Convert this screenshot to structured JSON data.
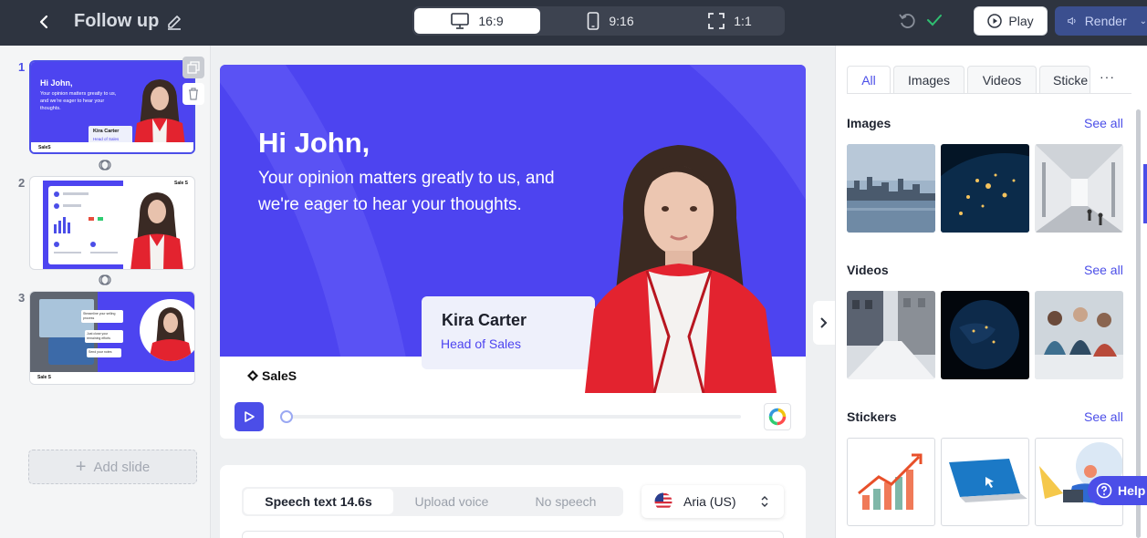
{
  "header": {
    "title": "Follow up",
    "ratios": [
      {
        "label": "16:9",
        "icon": "monitor-icon",
        "active": true
      },
      {
        "label": "9:16",
        "icon": "phone-icon",
        "active": false
      },
      {
        "label": "1:1",
        "icon": "square-frame-icon",
        "active": false
      }
    ],
    "play_label": "Play",
    "render_label": "Render"
  },
  "slides": {
    "items": [
      {
        "number": "1",
        "active": true,
        "greeting": "Hi John,",
        "message": "Your opinion matters greatly to us, and we're eager to hear your thoughts.",
        "name": "Kira Carter",
        "role": "Head of Sales",
        "brand": "SaleS"
      },
      {
        "number": "2",
        "active": false,
        "brand": "Sale S"
      },
      {
        "number": "3",
        "active": false,
        "bubble_1": "Streamline your selling process",
        "bubble_2": "Just close your remaining efforts",
        "bubble_3": "Send your notes",
        "brand": "Sale S"
      }
    ],
    "add_label": "Add slide"
  },
  "canvas": {
    "greeting": "Hi John,",
    "message": "Your opinion matters greatly to us, and we're eager to hear your thoughts.",
    "name": "Kira Carter",
    "role": "Head of Sales",
    "brand": "SaleS",
    "playback_progress": 0
  },
  "speech": {
    "tabs": [
      "Speech text 14.6s",
      "Upload voice",
      "No speech"
    ],
    "active_tab": 0,
    "voice": "Aria (US)"
  },
  "media": {
    "tabs": [
      "All",
      "Images",
      "Videos",
      "Sticke"
    ],
    "active_tab": 0,
    "sections": [
      {
        "title": "Images",
        "see_all": "See all",
        "items": [
          "city-skyline-image",
          "earth-night-image",
          "hall-interior-image"
        ]
      },
      {
        "title": "Videos",
        "see_all": "See all",
        "items": [
          "street-snow-video",
          "earth-globe-video",
          "team-meeting-video"
        ]
      },
      {
        "title": "Stickers",
        "see_all": "See all",
        "items": [
          "growth-chart-sticker",
          "laptop-sticker",
          "person-laptop-sticker"
        ]
      }
    ],
    "help_label": "Help"
  },
  "colors": {
    "accent": "#4b4ee8",
    "slide_bg": "#4d44f0",
    "topbar": "#2e3440"
  }
}
